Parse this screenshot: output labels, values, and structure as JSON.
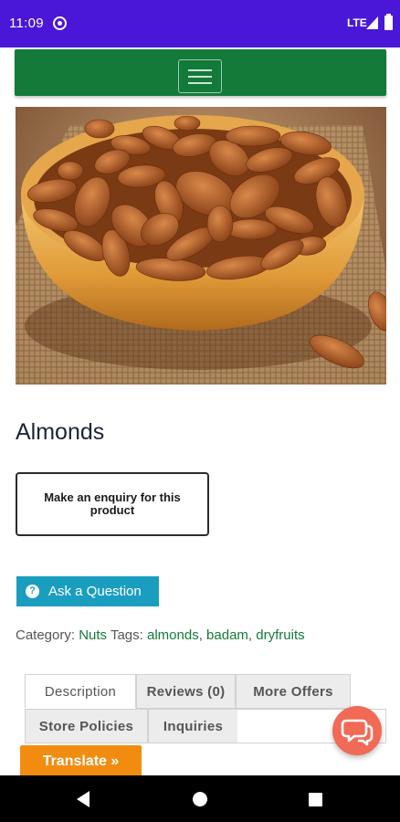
{
  "status_bar": {
    "time": "11:09",
    "network": "LTE",
    "sync_icon": "sync-icon",
    "signal_icon": "signal-icon",
    "battery_icon": "battery-icon"
  },
  "navbar": {
    "color": "#137a39",
    "menu_icon": "hamburger-menu-icon"
  },
  "product": {
    "title": "Almonds",
    "image_subject": "bowl-of-almonds-photo",
    "enquiry_label": "Make an enquiry for this product",
    "ask_label": "Ask a Question",
    "ask_icon": "question-circle-icon"
  },
  "meta": {
    "category_label": "Category:",
    "category": "Nuts",
    "tags_label": "Tags:",
    "tags": [
      "almonds",
      "badam",
      "dryfruits"
    ],
    "separator": ", "
  },
  "tabs": [
    {
      "label": "Description",
      "active": true
    },
    {
      "label": "Reviews (0)",
      "active": false
    },
    {
      "label": "More Offers",
      "active": false
    },
    {
      "label": "Store Policies",
      "active": false
    },
    {
      "label": "Inquiries",
      "active": false
    }
  ],
  "chat": {
    "icon": "chat-bubbles-icon",
    "color": "#f16a56"
  },
  "translate": {
    "label": "Translate »",
    "color": "#f28c10"
  },
  "colors": {
    "status_bar": "#4a16d8",
    "accent_green": "#137a39",
    "ask_button": "#1a9ec0"
  },
  "system_nav": {
    "back_icon": "back-triangle-icon",
    "home_icon": "home-circle-icon",
    "recents_icon": "recents-square-icon"
  }
}
